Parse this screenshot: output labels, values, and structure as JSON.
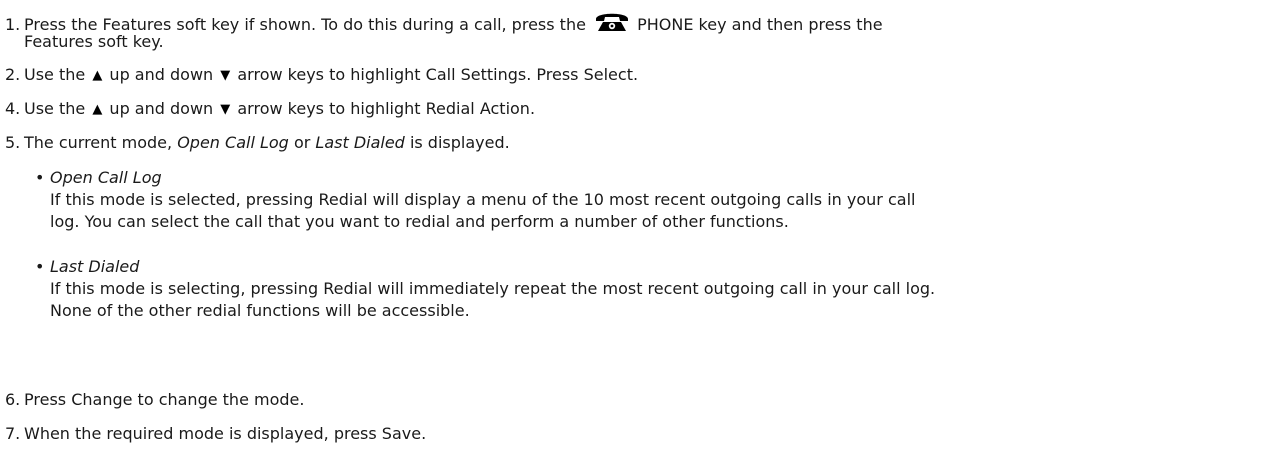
{
  "steps": {
    "s1": {
      "num": "1.",
      "a": "Press the Features soft key if shown. To do this during a call, press the",
      "b": "PHONE key and then press the",
      "c": "Features soft key."
    },
    "s2": {
      "num": "2.",
      "a": "Use the",
      "b": "up and down",
      "c": "arrow keys to highlight Call Settings. Press Select."
    },
    "s4": {
      "num": "4.",
      "a": "Use the",
      "b": "up and down",
      "c": "arrow keys to highlight Redial Action."
    },
    "s5": {
      "num": "5.",
      "a": "The current mode,",
      "b": "Open Call Log",
      "c": "or",
      "d": "Last Dialed",
      "e": "is displayed."
    },
    "s6": {
      "num": "6.",
      "a": "Press Change to change the mode."
    },
    "s7": {
      "num": "7.",
      "a": "When the required mode is displayed, press Save."
    }
  },
  "bullets": [
    {
      "title": "Open Call Log",
      "line1": "If this mode is selected, pressing Redial will display a menu of the 10 most recent outgoing calls in your call",
      "line2": "log. You can select the call that you want to redial and perform a number of other functions."
    },
    {
      "title": "Last Dialed",
      "line1": "If this mode is selecting, pressing Redial will immediately repeat the most recent outgoing call in your call log.",
      "line2": "None of the other redial functions will be accessible."
    }
  ],
  "icons": {
    "phone": "phone-key-icon",
    "up": "up-arrow-icon",
    "down": "down-arrow-icon",
    "bullet": "•",
    "up_glyph": "▲",
    "down_glyph": "▼"
  }
}
